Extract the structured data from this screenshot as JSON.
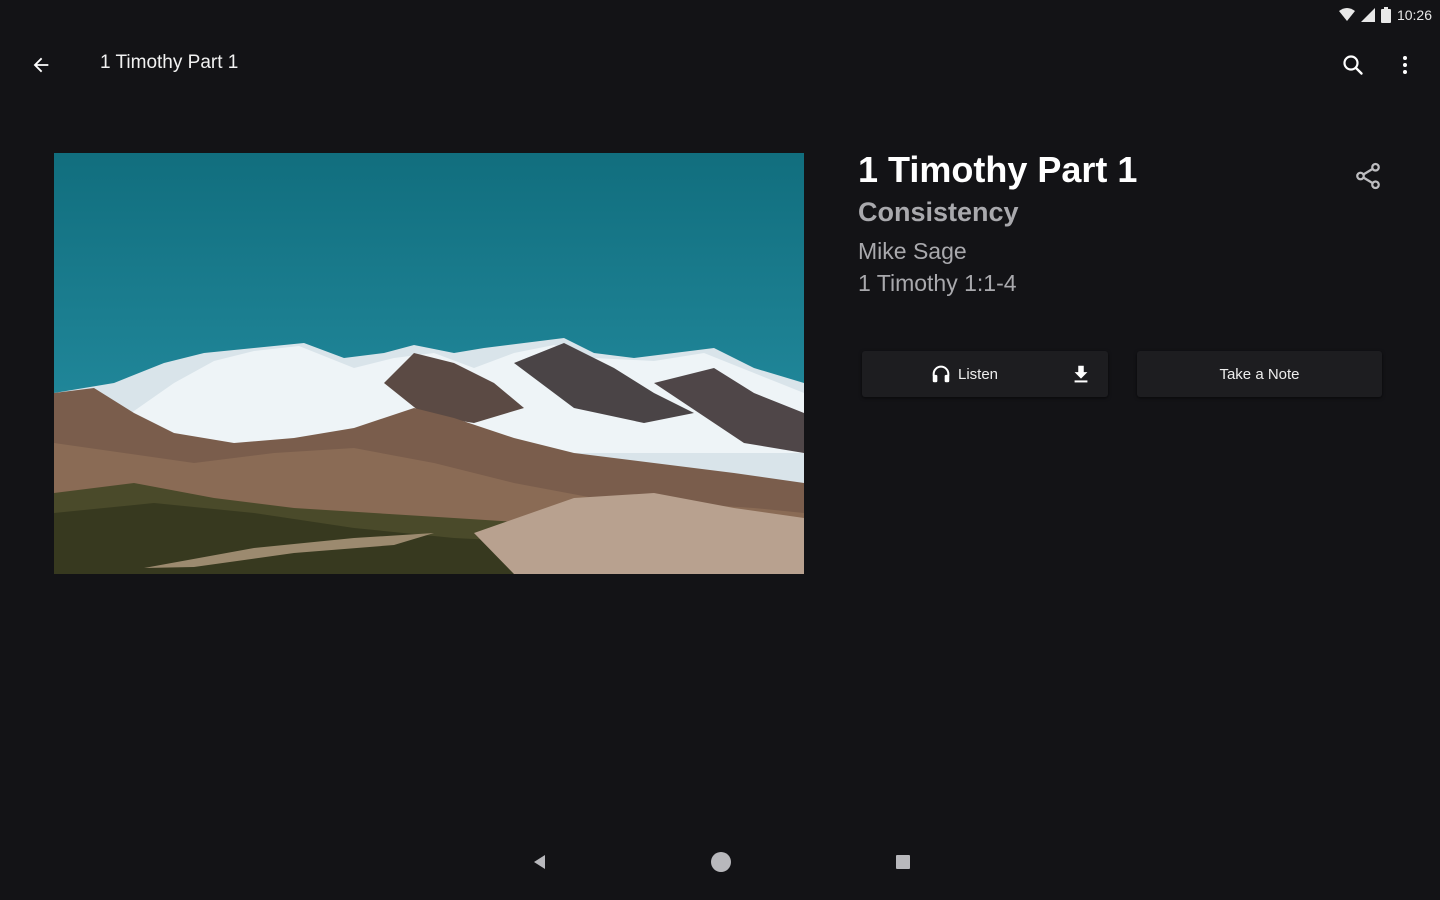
{
  "status_bar": {
    "time": "10:26",
    "icons": [
      "wifi-icon",
      "cell-signal-icon",
      "battery-icon"
    ]
  },
  "app_bar": {
    "title": "1 Timothy Part 1",
    "back_icon": "arrow-back-icon",
    "search_icon": "search-icon",
    "more_icon": "more-vert-icon"
  },
  "hero": {
    "image": "mountain-landscape-image"
  },
  "sermon": {
    "title": "1 Timothy Part 1",
    "series": "Consistency",
    "speaker": "Mike Sage",
    "passage": "1 Timothy 1:1-4",
    "share_icon": "share-icon"
  },
  "actions": {
    "listen_label": "Listen",
    "listen_icon": "headphones-icon",
    "download_icon": "download-icon",
    "note_label": "Take a Note"
  },
  "nav_bar": {
    "icons": [
      "nav-back-icon",
      "nav-home-icon",
      "nav-recents-icon"
    ]
  },
  "colors": {
    "background": "#131316",
    "button_bg": "#1d1d20",
    "secondary_text": "#a9a9ad"
  }
}
